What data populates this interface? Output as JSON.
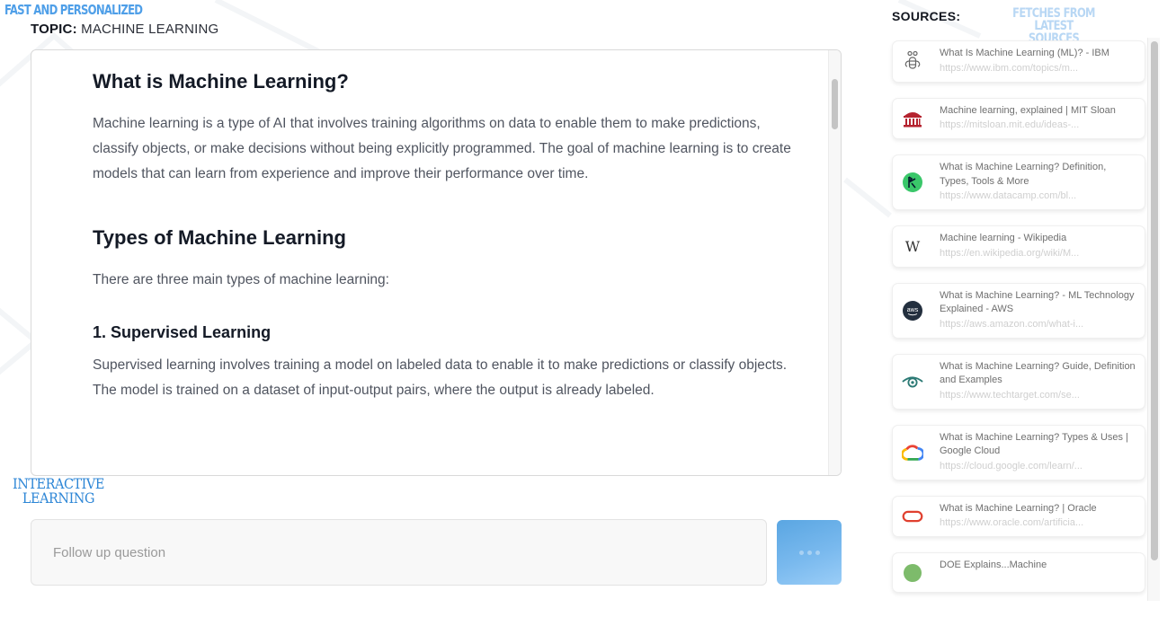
{
  "annotations": {
    "fast": "FAST AND PERSONALIZED",
    "interactive_line1": "INTERACTIVE",
    "interactive_line2": "LEARNING",
    "fetch_line1": "FETCHES FROM LATEST",
    "fetch_line2": "SOURCES"
  },
  "topic": {
    "label": "TOPIC:",
    "value": "MACHINE LEARNING"
  },
  "content": {
    "h1": "What is Machine Learning?",
    "p1": "Machine learning is a type of AI that involves training algorithms on data to enable them to make predictions, classify objects, or make decisions without being explicitly programmed. The goal of machine learning is to create models that can learn from experience and improve their performance over time.",
    "h2": "Types of Machine Learning",
    "p2": "There are three main types of machine learning:",
    "h3": "1. Supervised Learning",
    "p3": "Supervised learning involves training a model on labeled data to enable it to make predictions or classify objects. The model is trained on a dataset of input-output pairs, where the output is already labeled."
  },
  "followup": {
    "placeholder": "Follow up question",
    "value": ""
  },
  "send_button": {
    "icon": "ellipsis-icon"
  },
  "sources": {
    "title": "SOURCES:",
    "items": [
      {
        "title": "What Is Machine Learning (ML)? - IBM",
        "url": "https://www.ibm.com/topics/m...",
        "icon": "ibm-bee-icon"
      },
      {
        "title": "Machine learning, explained | MIT Sloan",
        "url": "https://mitsloan.mit.edu/ideas-...",
        "icon": "mit-sloan-icon"
      },
      {
        "title": "What is Machine Learning? Definition, Types, Tools & More",
        "url": "https://www.datacamp.com/bl...",
        "icon": "datacamp-icon"
      },
      {
        "title": "Machine learning - Wikipedia",
        "url": "https://en.wikipedia.org/wiki/M...",
        "icon": "wikipedia-icon"
      },
      {
        "title": "What is Machine Learning? - ML Technology Explained - AWS",
        "url": "https://aws.amazon.com/what-i...",
        "icon": "aws-icon"
      },
      {
        "title": "What is Machine Learning? Guide, Definition and Examples",
        "url": "https://www.techtarget.com/se...",
        "icon": "techtarget-eye-icon"
      },
      {
        "title": "What is Machine Learning? Types & Uses | Google Cloud",
        "url": "https://cloud.google.com/learn/...",
        "icon": "google-cloud-icon"
      },
      {
        "title": "What is Machine Learning? | Oracle",
        "url": "https://www.oracle.com/artificia...",
        "icon": "oracle-icon"
      },
      {
        "title": "DOE Explains...Machine",
        "url": "",
        "icon": "doe-icon"
      }
    ]
  }
}
